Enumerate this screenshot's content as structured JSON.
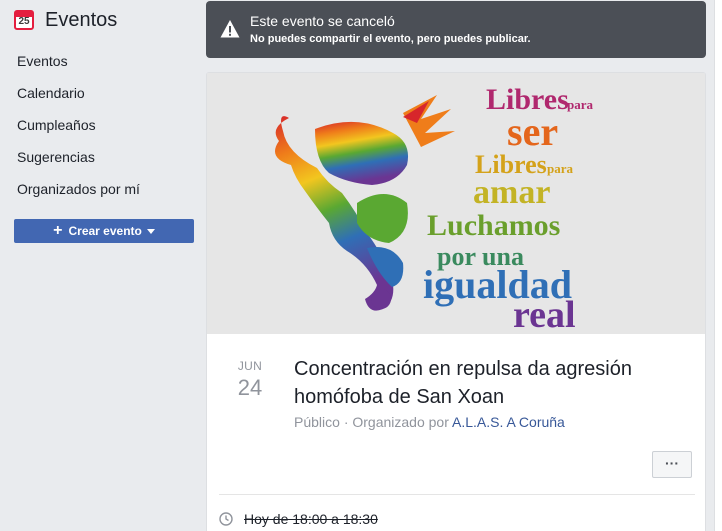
{
  "sidebar": {
    "icon_date": "25",
    "title": "Eventos",
    "items": [
      {
        "label": "Eventos"
      },
      {
        "label": "Calendario"
      },
      {
        "label": "Cumpleaños"
      },
      {
        "label": "Sugerencias"
      },
      {
        "label": "Organizados por mí"
      }
    ],
    "create_button": "Crear evento"
  },
  "alert": {
    "title": "Este evento se canceló",
    "subtitle": "No puedes compartir el evento, pero puedes publicar."
  },
  "cover": {
    "lines": [
      {
        "word": "Libres",
        "small": "para"
      },
      {
        "word": "ser"
      },
      {
        "word": "Libres",
        "small": "para"
      },
      {
        "word": "amar"
      },
      {
        "word": "Luchamos"
      },
      {
        "word": "por una"
      },
      {
        "word": "igualdad"
      },
      {
        "word": "real"
      }
    ]
  },
  "event": {
    "month": "JUN",
    "day": "24",
    "title": "Concentración en repulsa da agresión homófoba de San Xoan",
    "visibility": "Público",
    "organized_by_label": "· Organizado por",
    "organizer": "A.L.A.S. A Coruña",
    "more_label": "···",
    "time": "Hoy de 18:00 a 18:30"
  },
  "colors": {
    "accent": "#4267b2",
    "alert_bg": "#4b4f56",
    "link": "#385898",
    "calendar_red": "#e41e3f"
  }
}
